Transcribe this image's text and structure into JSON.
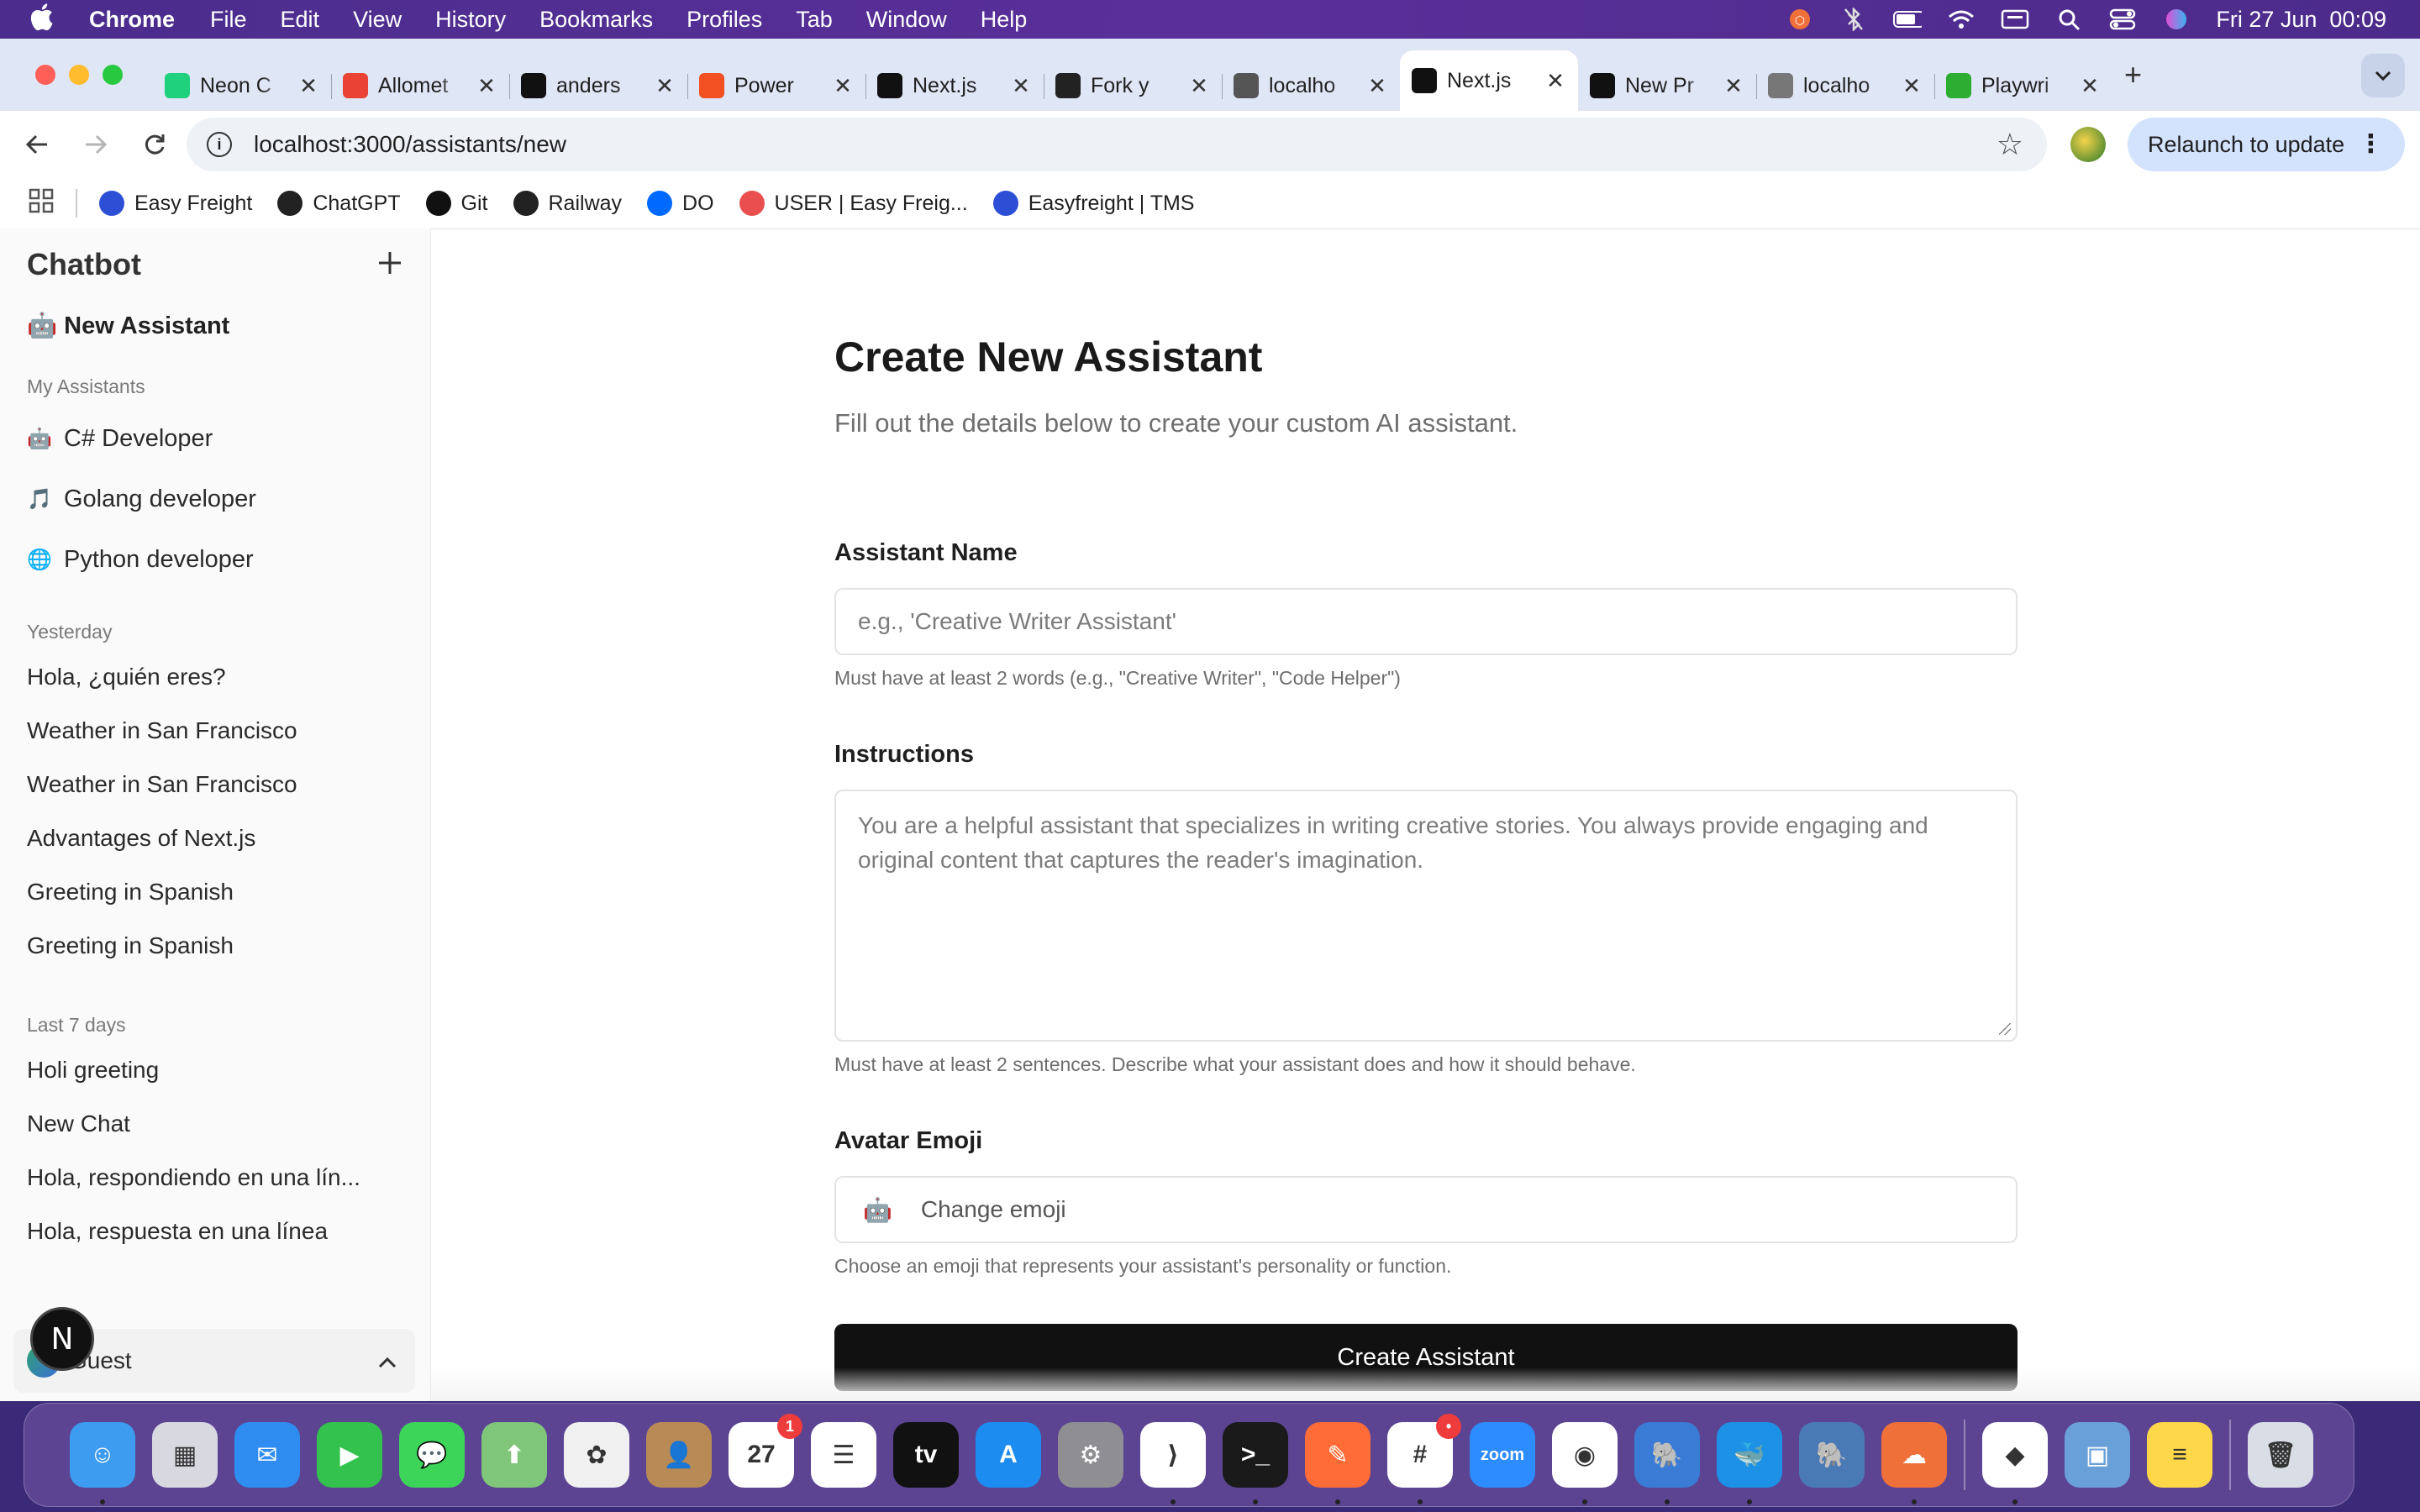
{
  "menubar": {
    "app": "Chrome",
    "items": [
      "File",
      "Edit",
      "View",
      "History",
      "Bookmarks",
      "Profiles",
      "Tab",
      "Window",
      "Help"
    ],
    "clock": "Fri 27 Jun  00:09"
  },
  "tabs": [
    {
      "title": "Neon C",
      "icon": "neon-icon",
      "color": "#1fd17c"
    },
    {
      "title": "Allomet",
      "icon": "gmail-icon",
      "color": "#ea4335"
    },
    {
      "title": "anders",
      "icon": "github-icon",
      "color": "#111111"
    },
    {
      "title": "Power",
      "icon": "microsoft-icon",
      "color": "#f25022"
    },
    {
      "title": "Next.js",
      "icon": "nextjs-icon",
      "color": "#111111"
    },
    {
      "title": "Fork y",
      "icon": "openai-icon",
      "color": "#222222"
    },
    {
      "title": "localho",
      "icon": "globe-icon",
      "color": "#555555"
    },
    {
      "title": "Next.js",
      "icon": "nextjs-icon",
      "color": "#111111",
      "active": true
    },
    {
      "title": "New Pr",
      "icon": "vercel-icon",
      "color": "#111111"
    },
    {
      "title": "localho",
      "icon": "bird-icon",
      "color": "#777777"
    },
    {
      "title": "Playwri",
      "icon": "playwright-icon",
      "color": "#2ead33"
    }
  ],
  "toolbar": {
    "url": "localhost:3000/assistants/new",
    "relaunch": "Relaunch to update"
  },
  "bookmarks": [
    {
      "label": "Easy Freight",
      "color": "#2d4fd6"
    },
    {
      "label": "ChatGPT",
      "color": "#222222"
    },
    {
      "label": "Git",
      "color": "#111111"
    },
    {
      "label": "Railway",
      "color": "#222222"
    },
    {
      "label": "DO",
      "color": "#0069ff"
    },
    {
      "label": "USER | Easy Freig...",
      "color": "#e94f4f"
    },
    {
      "label": "Easyfreight | TMS",
      "color": "#2d4fd6"
    }
  ],
  "sidebar": {
    "title": "Chatbot",
    "new_assistant": "🤖 New Assistant",
    "my_assistants_label": "My Assistants",
    "assistants": [
      {
        "emoji": "🤖",
        "name": "C# Developer"
      },
      {
        "emoji": "🎵",
        "name": "Golang developer"
      },
      {
        "emoji": "🌐",
        "name": "Python developer"
      }
    ],
    "yesterday_label": "Yesterday",
    "yesterday": [
      "Hola, ¿quién eres?",
      "Weather in San Francisco",
      "Weather in San Francisco",
      "Advantages of Next.js",
      "Greeting in Spanish",
      "Greeting in Spanish"
    ],
    "last7_label": "Last 7 days",
    "last7": [
      "Holi greeting",
      "New Chat",
      "Hola, respondiendo en una lín...",
      "Hola, respuesta en una línea"
    ],
    "user": "Guest",
    "badge": "N"
  },
  "form": {
    "title": "Create New Assistant",
    "subtitle": "Fill out the details below to create your custom AI assistant.",
    "name_label": "Assistant Name",
    "name_placeholder": "e.g., 'Creative Writer Assistant'",
    "name_hint": "Must have at least 2 words (e.g., \"Creative Writer\", \"Code Helper\")",
    "instructions_label": "Instructions",
    "instructions_placeholder": "You are a helpful assistant that specializes in writing creative stories. You always provide engaging and original content that captures the reader's imagination.",
    "instructions_hint": "Must have at least 2 sentences. Describe what your assistant does and how it should behave.",
    "emoji_label": "Avatar Emoji",
    "emoji_value": "🤖",
    "emoji_button": "Change emoji",
    "emoji_hint": "Choose an emoji that represents your assistant's personality or function.",
    "submit": "Create Assistant"
  },
  "dock": [
    {
      "name": "finder-icon",
      "color": "#3d9bf0",
      "glyph": "☺",
      "running": true
    },
    {
      "name": "launchpad-icon",
      "color": "#d8d8e0",
      "glyph": "▦"
    },
    {
      "name": "mail-icon",
      "color": "#2f8cf0",
      "glyph": "✉"
    },
    {
      "name": "facetime-icon",
      "color": "#33c24d",
      "glyph": "▶"
    },
    {
      "name": "messages-icon",
      "color": "#3dd45a",
      "glyph": "💬"
    },
    {
      "name": "maps-icon",
      "color": "#7fc67a",
      "glyph": "⬆"
    },
    {
      "name": "photos-icon",
      "color": "#f0f0f0",
      "glyph": "✿"
    },
    {
      "name": "contacts-icon",
      "color": "#b88a55",
      "glyph": "👤"
    },
    {
      "name": "calendar-icon",
      "color": "#ffffff",
      "glyph": "27",
      "badge": "1"
    },
    {
      "name": "reminders-icon",
      "color": "#ffffff",
      "glyph": "☰"
    },
    {
      "name": "tv-icon",
      "color": "#111111",
      "glyph": "tv"
    },
    {
      "name": "app-store-icon",
      "color": "#1d8cf0",
      "glyph": "A"
    },
    {
      "name": "settings-icon",
      "color": "#8e8e93",
      "glyph": "⚙"
    },
    {
      "name": "vscode-icon",
      "color": "#ffffff",
      "glyph": "⟩",
      "running": true
    },
    {
      "name": "terminal-icon",
      "color": "#1a1a1a",
      "glyph": ">_",
      "running": true
    },
    {
      "name": "postman-icon",
      "color": "#ff6c37",
      "glyph": "✎",
      "running": true
    },
    {
      "name": "slack-icon",
      "color": "#ffffff",
      "glyph": "#",
      "badge": "•",
      "running": true
    },
    {
      "name": "zoom-icon",
      "color": "#2d8cff",
      "glyph": "zoom"
    },
    {
      "name": "chrome-icon",
      "color": "#ffffff",
      "glyph": "◉",
      "running": true
    },
    {
      "name": "tableplus-icon",
      "color": "#3a7bd5",
      "glyph": "🐘",
      "running": true
    },
    {
      "name": "docker-icon",
      "color": "#1d91e6",
      "glyph": "🐳",
      "running": true
    },
    {
      "name": "pgadmin-icon",
      "color": "#4a7ab5",
      "glyph": "🐘"
    },
    {
      "name": "cloud-vpn-icon",
      "color": "#f0703a",
      "glyph": "☁",
      "running": true
    },
    {
      "name": "separator"
    },
    {
      "name": "cube-app-icon",
      "color": "#ffffff",
      "glyph": "◆",
      "running": true
    },
    {
      "name": "preview-icon",
      "color": "#6aa0d8",
      "glyph": "▣"
    },
    {
      "name": "notes-icon",
      "color": "#ffd84a",
      "glyph": "≡"
    },
    {
      "name": "separator"
    },
    {
      "name": "trash-icon",
      "color": "#d8dde6",
      "glyph": "🗑"
    }
  ]
}
